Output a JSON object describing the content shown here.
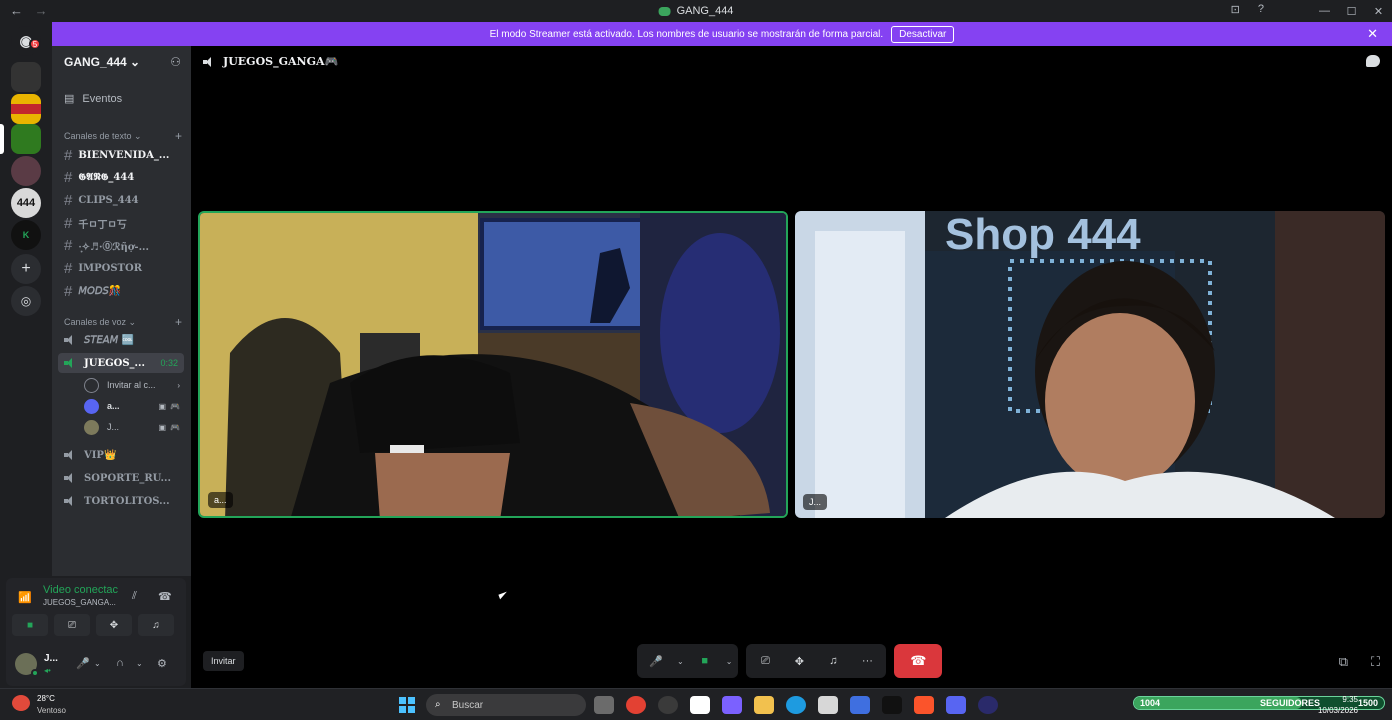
{
  "window": {
    "title": "GANG_444",
    "nav_back": "←",
    "nav_forward": "→",
    "minimize": "—",
    "maximize": "☐",
    "close": "✕",
    "inbox_icon": "inbox-icon",
    "help": "?"
  },
  "streamer_banner": {
    "text": "El modo Streamer está activado. Los nombres de usuario se mostrarán de forma parcial.",
    "button": "Desactivar",
    "close": "✕"
  },
  "servers": {
    "home_badge": "5"
  },
  "guild": {
    "name": "GANG_444 ⌄",
    "add_icon": "person-add-icon"
  },
  "events_label": "Eventos",
  "text_category": {
    "label": "Canales de texto ⌄",
    "add": "+"
  },
  "text_channels": [
    {
      "name": "BIENVENIDA_..."
    },
    {
      "name": "𝕲𝕬𝕹𝕲_444"
    },
    {
      "name": "CLIPS_444"
    },
    {
      "name": "千ㅁ丁ㅁ丂"
    },
    {
      "name": "·̩͙✧♬·⓪ℛῆợ-..."
    },
    {
      "name": "IMPOSTOR"
    },
    {
      "name": "𝘔𝘖𝘋𝘚🎊"
    }
  ],
  "voice_category": {
    "label": "Canales de voz ⌄",
    "add": "+"
  },
  "voice_channels": [
    {
      "name": "𝘚𝘛𝘌𝘈𝘔 🆒"
    },
    {
      "name": "JUEGOS_...",
      "timer": "0:32"
    }
  ],
  "voice_invite": {
    "label": "Invitar al c...",
    "arrow": "›"
  },
  "voice_users": [
    {
      "name": "a...",
      "icons": "▣",
      "activity": "🎮"
    },
    {
      "name": "J...",
      "icons": "▣",
      "activity": "🎮"
    }
  ],
  "other_voice": [
    {
      "name": "VIP👑"
    },
    {
      "name": "SOPORTE_RU..."
    },
    {
      "name": "TORTOLITOS..."
    }
  ],
  "rtc": {
    "status": "Video conectac",
    "channel": "JUEGOS_GANGA..."
  },
  "user": {
    "name": "J...",
    "sub": "◂•"
  },
  "call": {
    "channel": "JUEGOS_GANGA🎮",
    "tile_left_name": "a...",
    "tile_right_name": "J...",
    "invite": "Invitar"
  },
  "tiles": {
    "right_sign": "Shop 444"
  },
  "controls": {
    "mic": "🎤",
    "cam": "■",
    "share": "⎚",
    "activities": "✥",
    "soundboard": "♫",
    "more": "···",
    "hangup": "☎",
    "chevron": "⌄"
  },
  "taskbar": {
    "temp": "28°C",
    "weather": "Ventoso",
    "search": "Buscar",
    "followers_count": "1004",
    "followers_label": "SEGUIDORES",
    "followers_goal": "1500",
    "followers_progress": 0.67,
    "time": "9:35",
    "date": "10/03/2026",
    "lang": "LAA"
  }
}
